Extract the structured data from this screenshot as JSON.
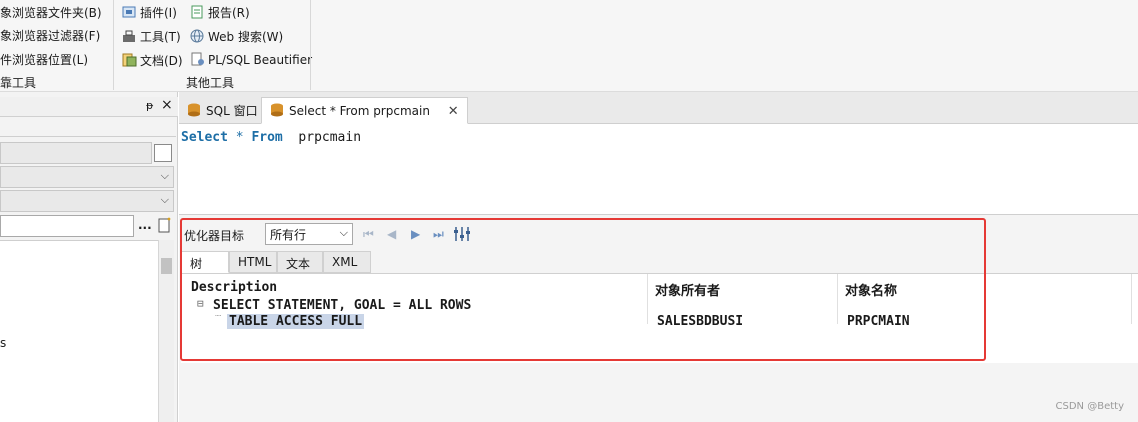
{
  "ribbon": {
    "group1": {
      "items": [
        "象浏览器文件夹(B)",
        "象浏览器过滤器(F)",
        "件浏览器位置(L)"
      ],
      "label": "靠工具"
    },
    "group2": {
      "items": [
        "插件(I)",
        "工具(T)",
        "文档(D)",
        "报告(R)",
        "Web 搜索(W)",
        "PL/SQL Beautifier"
      ],
      "label": "其他工具"
    }
  },
  "left_panel": {
    "pin_glyph": "ᵽ",
    "close_glyph": "×",
    "ellipsis": "..."
  },
  "tabs": [
    {
      "label": "SQL 窗口",
      "icon": "sql-window-icon"
    },
    {
      "label": "Select * From prpcmain",
      "icon": "sql-query-icon",
      "close": "✕"
    }
  ],
  "editor": {
    "kw1": "Select",
    "star": "*",
    "kw2": "From",
    "table": "prpcmain"
  },
  "plan": {
    "optimizer_label": "优化器目标",
    "optimizer_value": "所有行",
    "subtabs": [
      "树",
      "HTML",
      "文本",
      "XML"
    ],
    "columns": [
      "Description",
      "对象所有者",
      "对象名称"
    ],
    "rows": [
      {
        "description": "SELECT STATEMENT, GOAL = ALL ROWS",
        "owner": "",
        "name": ""
      },
      {
        "description": "TABLE ACCESS FULL",
        "owner": "SALESBDBUSI",
        "name": "PRPCMAIN"
      }
    ]
  },
  "watermark": "CSDN @Betty",
  "colors": {
    "highlight_box": "#e53935",
    "keyword": "#1d6ea6",
    "selection": "#c9d5e8"
  }
}
